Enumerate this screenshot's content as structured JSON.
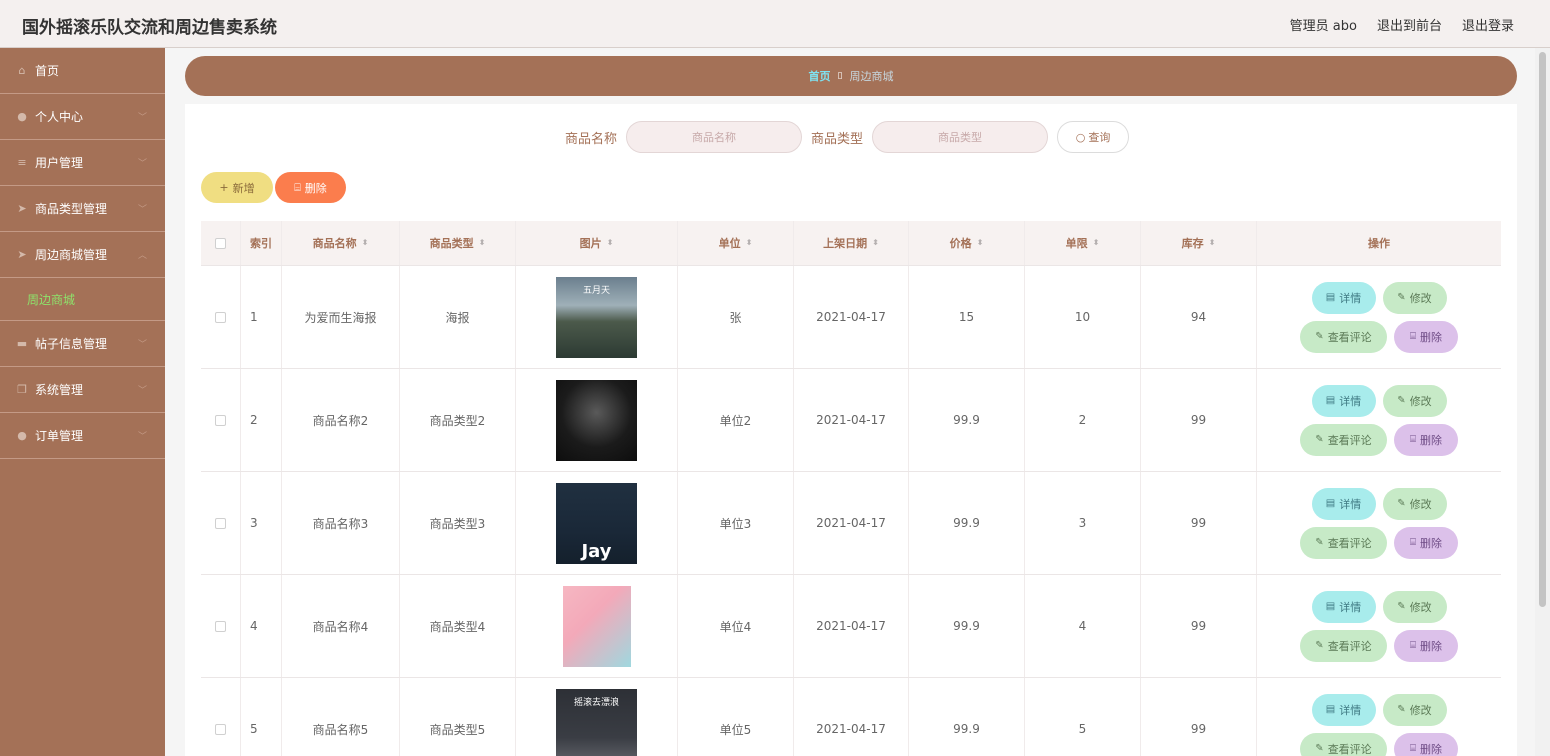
{
  "header": {
    "title": "国外摇滚乐队交流和周边售卖系统",
    "user": "管理员 abo",
    "to_front": "退出到前台",
    "logout": "退出登录"
  },
  "sidebar": {
    "items": [
      {
        "label": "首页",
        "icon": "home-icon",
        "glyph": "⌂"
      },
      {
        "label": "个人中心",
        "icon": "user-icon",
        "glyph": "●"
      },
      {
        "label": "用户管理",
        "icon": "list-icon",
        "glyph": "≡"
      },
      {
        "label": "商品类型管理",
        "icon": "send-icon",
        "glyph": "➤"
      },
      {
        "label": "周边商城管理",
        "icon": "send-icon",
        "glyph": "➤"
      },
      {
        "label": "周边商城",
        "sub": true
      },
      {
        "label": "帖子信息管理",
        "icon": "message-icon",
        "glyph": "▬"
      },
      {
        "label": "系统管理",
        "icon": "copy-icon",
        "glyph": "❐"
      },
      {
        "label": "订单管理",
        "icon": "user-icon",
        "glyph": "●"
      }
    ]
  },
  "breadcrumb": {
    "home": "首页",
    "current": "周边商城"
  },
  "search": {
    "name_label": "商品名称",
    "name_placeholder": "商品名称",
    "type_label": "商品类型",
    "type_placeholder": "商品类型",
    "query_label": "查询"
  },
  "toolbar": {
    "add_label": "新增",
    "delete_label": "删除"
  },
  "table": {
    "columns": [
      "索引",
      "商品名称",
      "商品类型",
      "图片",
      "单位",
      "上架日期",
      "价格",
      "单限",
      "库存",
      "操作"
    ],
    "rows": [
      {
        "index": "1",
        "name": "为爱而生海报",
        "type": "海报",
        "unit": "张",
        "date": "2021-04-17",
        "price": "15",
        "limit": "10",
        "stock": "94",
        "img_caption": "五月天"
      },
      {
        "index": "2",
        "name": "商品名称2",
        "type": "商品类型2",
        "unit": "单位2",
        "date": "2021-04-17",
        "price": "99.9",
        "limit": "2",
        "stock": "99",
        "img_caption": ""
      },
      {
        "index": "3",
        "name": "商品名称3",
        "type": "商品类型3",
        "unit": "单位3",
        "date": "2021-04-17",
        "price": "99.9",
        "limit": "3",
        "stock": "99",
        "img_caption": "Jay"
      },
      {
        "index": "4",
        "name": "商品名称4",
        "type": "商品类型4",
        "unit": "单位4",
        "date": "2021-04-17",
        "price": "99.9",
        "limit": "4",
        "stock": "99",
        "img_caption": ""
      },
      {
        "index": "5",
        "name": "商品名称5",
        "type": "商品类型5",
        "unit": "单位5",
        "date": "2021-04-17",
        "price": "99.9",
        "limit": "5",
        "stock": "99",
        "img_caption": "摇滚去漂浪"
      }
    ],
    "op_labels": {
      "detail": "详情",
      "edit": "修改",
      "comment": "查看评论",
      "delete": "删除"
    }
  },
  "colors": {
    "brand": "#a47157",
    "active_menu": "#8ee26b",
    "add_btn": "#f0de82",
    "delete_btn": "#fb7d4d"
  }
}
